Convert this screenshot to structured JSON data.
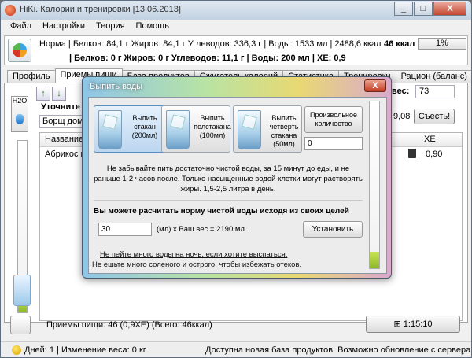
{
  "window": {
    "title": "HiKi. Калории и тренировки [13.06.2013]",
    "controls": [
      "_",
      "□",
      "X"
    ]
  },
  "menu": [
    "Файл",
    "Настройки",
    "Теория",
    "Помощь"
  ],
  "stats": {
    "line1": "Норма | Белков: 84,1 г Жиров: 84,1 г Углеводов: 336,3 г | Воды: 1533 мл | 2488,6 ккал",
    "line2": "| Белков: 0 г Жиров: 0 г Углеводов: 11,1 г | Воды: 200 мл | ХЕ: 0,9",
    "kcal": "46 ккал",
    "progress_text": "1%",
    "progress": 0.01
  },
  "tabs": [
    "Профиль",
    "Приемы пищи",
    "База продуктов",
    "Сжигатель калорий",
    "Статистика",
    "Тренировки",
    "Рацион (баланс)"
  ],
  "active_tab": 1,
  "left_panel": {
    "h2o_label": "H2O",
    "water_level": 0.08
  },
  "meals": {
    "hint_label": "Уточните н",
    "food_input": "Борщ домаш",
    "weight_label": "вес:",
    "weight_value": "73",
    "value_908": "9,08",
    "eat_button": "Съесть!",
    "columns": [
      "Название",
      "ХЕ"
    ],
    "rows": [
      {
        "name": "Абрикос в",
        "xe": "0,90"
      }
    ]
  },
  "bottom": {
    "info": "Приемы пищи:  46 (0,9ХЕ) (Всего: 46ккал)",
    "timer": "1:15:10"
  },
  "status": {
    "days": "Дней: 1 | Изменение веса: 0 кг",
    "news": "Доступна новая база продуктов. Возможно обновление с сервера"
  },
  "dialog": {
    "title": "Выпить воды",
    "close": "X",
    "buttons": [
      {
        "label1": "Выпить",
        "label2": "стакан",
        "label3": "(200мл)"
      },
      {
        "label1": "Выпить",
        "label2": "полстакана",
        "label3": "(100мл)"
      },
      {
        "label1": "Выпить",
        "label2": "четверть стакана",
        "label3": "(50мл)"
      }
    ],
    "custom_label": "Произвольное количество",
    "custom_value": "0",
    "tip": "Не забывайте пить достаточно чистой воды, за 15 минут до еды, и не раньше 1-2 часов после. Только насыщенные водой клетки могут растворять жиры. 1,5-2,5 литра в день.",
    "calc_heading": "Вы можете расчитать норму чистой воды исходя из своих целей",
    "calc_value": "30",
    "calc_result": "(мл) х Ваш вес = 2190 мл.",
    "set_button": "Установить",
    "link1": "Не пейте много воды на ночь, если хотите выспаться.",
    "link2": "Не ешьте много соленого и острого, чтобы избежать отеков.",
    "water_level": 0.1
  }
}
